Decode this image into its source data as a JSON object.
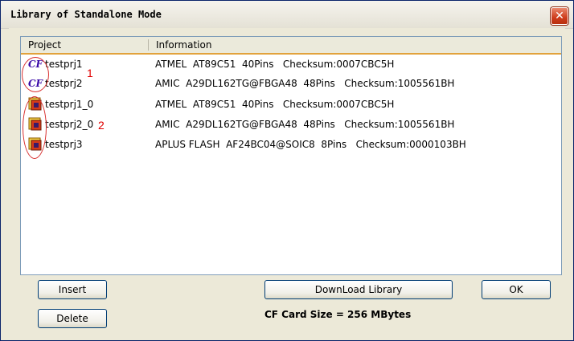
{
  "window": {
    "title": "Library of Standalone Mode",
    "close_label": "✕"
  },
  "list": {
    "columns": {
      "project": "Project",
      "information": "Information"
    },
    "rows": [
      {
        "icon": "cf-card-icon",
        "name": "testprj1",
        "info": "ATMEL  AT89C51  40Pins   Checksum:0007CBC5H"
      },
      {
        "icon": "cf-card-icon",
        "name": "testprj2",
        "info": "AMIC  A29DL162TG@FBGA48  48Pins   Checksum:1005561BH"
      },
      {
        "icon": "chip-project-icon",
        "name": "testprj1_0",
        "info": "ATMEL  AT89C51  40Pins   Checksum:0007CBC5H"
      },
      {
        "icon": "chip-project-icon",
        "name": "testprj2_0",
        "info": "AMIC  A29DL162TG@FBGA48  48Pins   Checksum:1005561BH"
      },
      {
        "icon": "chip-project-icon",
        "name": "testprj3",
        "info": "APLUS FLASH  AF24BC04@SOIC8  8Pins   Checksum:0000103BH"
      }
    ],
    "cf_icon_text": "CF"
  },
  "annotations": {
    "one": "1",
    "two": "2"
  },
  "buttons": {
    "insert": "Insert",
    "delete": "Delete",
    "download": "DownLoad Library",
    "ok": "OK"
  },
  "cf_card_size": "CF Card Size = 256 MBytes"
}
